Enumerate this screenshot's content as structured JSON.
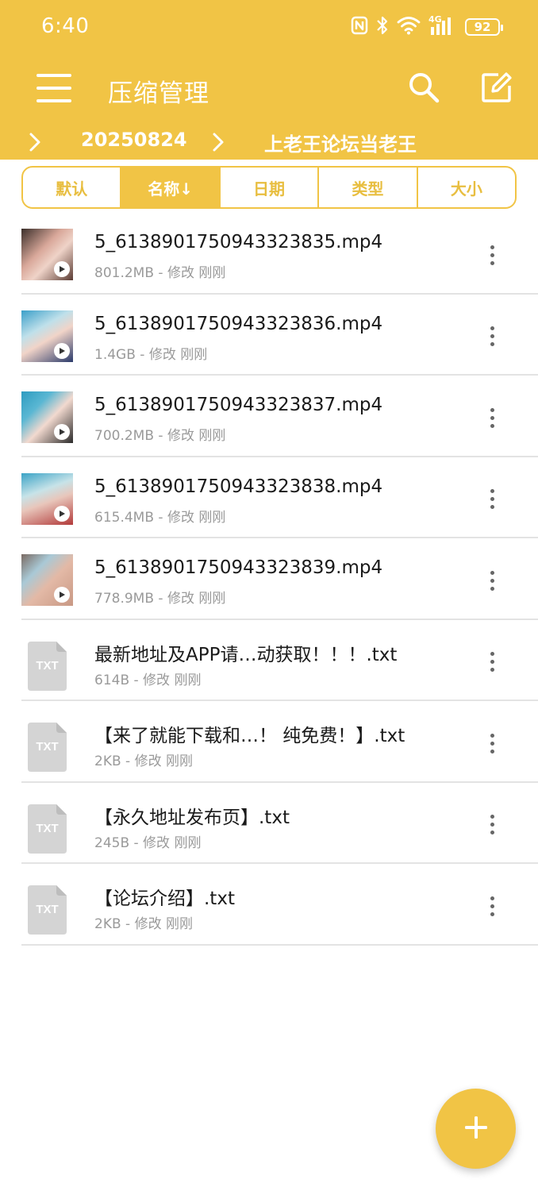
{
  "status_bar": {
    "time": "6:40",
    "network": "4G",
    "battery": "92",
    "icons": [
      "nfc-icon",
      "bluetooth-icon",
      "wifi-icon",
      "signal-icon",
      "battery-icon"
    ]
  },
  "app_bar": {
    "title": "压缩管理",
    "icons": [
      "menu-icon",
      "search-icon",
      "edit-icon"
    ]
  },
  "breadcrumb": [
    "20250824",
    "上老王论坛当老王"
  ],
  "sort_tabs": [
    {
      "label": "默认",
      "active": false
    },
    {
      "label": "名称↓",
      "active": true
    },
    {
      "label": "日期",
      "active": false
    },
    {
      "label": "类型",
      "active": false
    },
    {
      "label": "大小",
      "active": false
    }
  ],
  "files": [
    {
      "name": "5_6138901750943323835.mp4",
      "meta": "801.2MB - 修改 刚刚",
      "type": "video"
    },
    {
      "name": "5_6138901750943323836.mp4",
      "meta": "1.4GB - 修改 刚刚",
      "type": "video"
    },
    {
      "name": "5_6138901750943323837.mp4",
      "meta": "700.2MB - 修改 刚刚",
      "type": "video"
    },
    {
      "name": "5_6138901750943323838.mp4",
      "meta": "615.4MB - 修改 刚刚",
      "type": "video"
    },
    {
      "name": "5_6138901750943323839.mp4",
      "meta": "778.9MB - 修改 刚刚",
      "type": "video"
    },
    {
      "name": "最新地址及APP请…动获取！！！.txt",
      "meta": "614B - 修改 刚刚",
      "type": "txt"
    },
    {
      "name": "【来了就能下载和…！ 纯免费！】.txt",
      "meta": "2KB - 修改 刚刚",
      "type": "txt"
    },
    {
      "name": "【永久地址发布页】.txt",
      "meta": "245B - 修改 刚刚",
      "type": "txt"
    },
    {
      "name": "【论坛介绍】.txt",
      "meta": "2KB - 修改 刚刚",
      "type": "txt"
    }
  ],
  "txt_icon_label": "TXT",
  "fab": {
    "icon": "plus-icon"
  },
  "colors": {
    "accent": "#F1C445",
    "divider": "#E3E3E3",
    "meta_text": "#9A9A9A"
  }
}
